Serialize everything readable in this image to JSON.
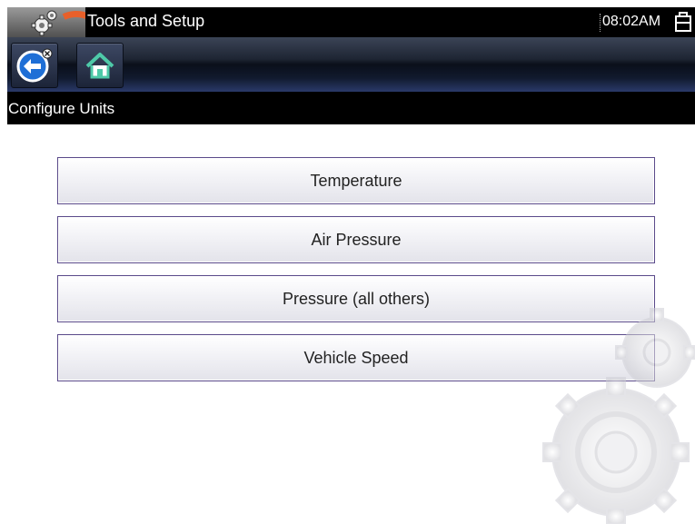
{
  "titlebar": {
    "title": "Tools and Setup",
    "time": "08:02AM",
    "app_icon": "tools-gear-icon",
    "status_icon": "battery-icon"
  },
  "toolbar": {
    "back_icon": "back-arrow-icon",
    "home_icon": "home-icon"
  },
  "subbar": {
    "title": "Configure Units"
  },
  "menu": {
    "items": [
      {
        "label": "Temperature"
      },
      {
        "label": "Air Pressure"
      },
      {
        "label": "Pressure (all others)"
      },
      {
        "label": "Vehicle Speed"
      }
    ]
  },
  "colors": {
    "accent_orange": "#e8602a",
    "back_button_blue": "#1f6fd6",
    "home_icon_green": "#4ec9a8",
    "button_border": "#5a4a8a"
  }
}
